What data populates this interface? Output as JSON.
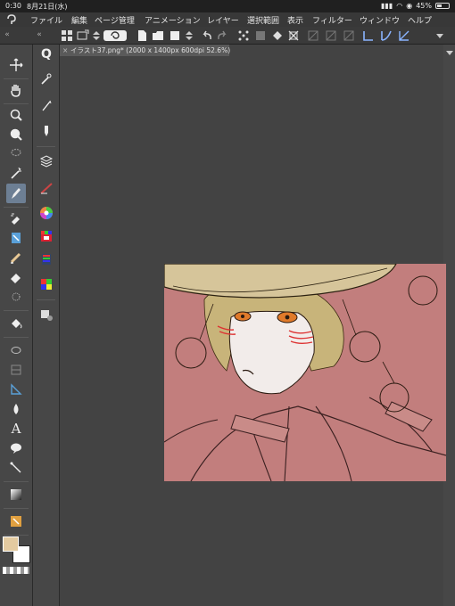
{
  "status_bar": {
    "time": "0:30",
    "date": "8月21日(水)",
    "battery": "45%",
    "battery_level": 0.45
  },
  "menu": {
    "items": [
      "ファイル",
      "編集",
      "ページ管理",
      "アニメーション",
      "レイヤー",
      "選択範囲",
      "表示",
      "フィルター",
      "ウィンドウ",
      "ヘルプ"
    ]
  },
  "document": {
    "tab_title": "イラスト37.png* (2000 x 1400px 600dpi 52.6%)"
  },
  "tools_col1": [
    "move-layer",
    "hand",
    "zoom-in",
    "zoom-out",
    "lasso",
    "pen",
    "brush",
    "fill",
    "eraser",
    "blend",
    "eyedropper",
    "ellipse",
    "frame",
    "ruler",
    "drop",
    "text",
    "balloon",
    "line",
    "gradient",
    "select-object",
    "layer"
  ],
  "tools_col2": [
    "magic-wand",
    "pen-sub",
    "pencil-sub",
    "ruler-sub",
    "water-brush",
    "color-circle",
    "color-slider",
    "color-set",
    "intermediate-color",
    "similar-color",
    "sub-tool-detail"
  ],
  "colors": {
    "main": "#e3caa0",
    "sub": "#ffffff",
    "canvas_bg": "#c27e7d",
    "hat": "#d6c59a",
    "skin": "#f2ecea",
    "eye": "#e07a2a",
    "hair": "#c8b47a",
    "accent_selected": "#6d7f94"
  }
}
